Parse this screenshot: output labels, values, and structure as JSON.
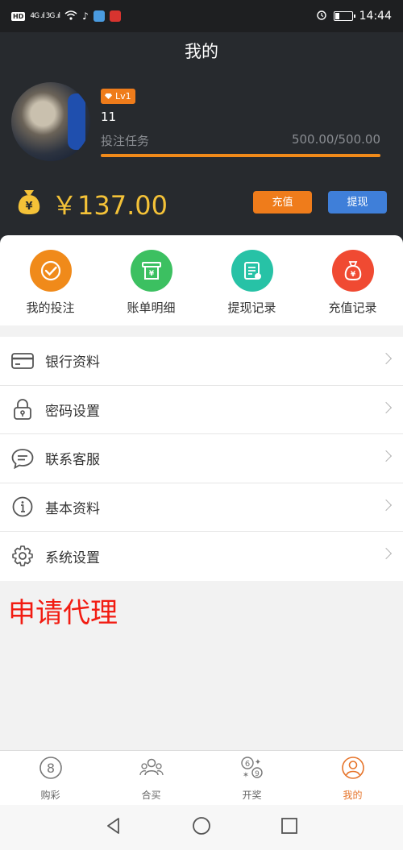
{
  "status_bar": {
    "time": "14:44",
    "left_chip": "HD",
    "signal": "4G .ıl 3G .ıl"
  },
  "header": {
    "title": "我的",
    "level": "Lv1",
    "username": "11",
    "task_label": "投注任务",
    "task_value": "500.00/500.00",
    "task_progress": 1.0,
    "balance": "￥137.00",
    "recharge_label": "充值",
    "withdraw_label": "提现"
  },
  "quick_actions": [
    {
      "label": "我的投注",
      "icon": "bet-check-icon",
      "color": "#f08a1a"
    },
    {
      "label": "账单明细",
      "icon": "bill-icon",
      "color": "#3cc061"
    },
    {
      "label": "提现记录",
      "icon": "withdraw-record-icon",
      "color": "#27c2a6"
    },
    {
      "label": "充值记录",
      "icon": "money-bag-icon",
      "color": "#f04a32"
    }
  ],
  "menu": [
    {
      "label": "银行资料",
      "icon": "bank-card-icon"
    },
    {
      "label": "密码设置",
      "icon": "lock-icon"
    },
    {
      "label": "联系客服",
      "icon": "chat-icon"
    },
    {
      "label": "基本资料",
      "icon": "info-icon"
    },
    {
      "label": "系统设置",
      "icon": "gear-icon"
    }
  ],
  "agent_link": "申请代理",
  "tabs": [
    {
      "label": "购彩",
      "icon": "lottery-ball-icon",
      "active": false
    },
    {
      "label": "合买",
      "icon": "group-buy-icon",
      "active": false
    },
    {
      "label": "开奖",
      "icon": "draw-result-icon",
      "active": false
    },
    {
      "label": "我的",
      "icon": "user-icon",
      "active": true
    }
  ],
  "colors": {
    "accent": "#ef7c1b",
    "blue": "#3f7fd9",
    "balance": "#f4c238",
    "agent": "#f21c12",
    "header_bg": "#272a2e"
  }
}
